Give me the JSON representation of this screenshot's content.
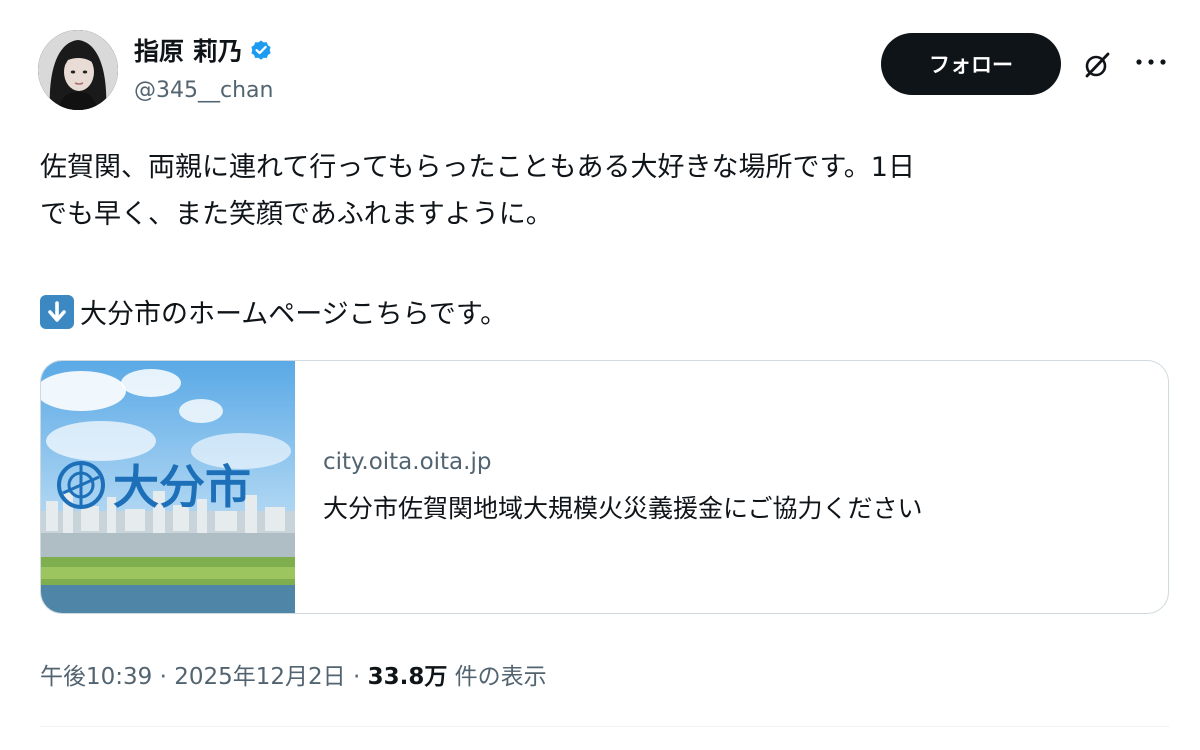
{
  "author": {
    "display_name": "指原 莉乃",
    "handle": "@345__chan",
    "verified": true,
    "avatar": "portrait-photo"
  },
  "header": {
    "follow_label": "フォロー",
    "grok_icon": "grok-slash-circle-icon",
    "more_icon": "more-dots-icon"
  },
  "tweet": {
    "text": "佐賀関、両親に連れて行ってもらったこともある大好きな場所です。1日\nでも早く、また笑顔であふれますように。",
    "link_line_emoji": "down-arrow-emoji",
    "link_line_text": "大分市のホームページこちらです。"
  },
  "card": {
    "thumbnail_logo_text": "大分市",
    "domain": "city.oita.oita.jp",
    "title": "大分市佐賀関地域大規模火災義援金にご協力ください"
  },
  "meta": {
    "time": "午後10:39",
    "sep1": " · ",
    "date": "2025年12月2日",
    "sep2": " · ",
    "views_count": "33.8万",
    "views_label": " 件の表示"
  },
  "colors": {
    "text_primary": "#0f1419",
    "text_secondary": "#536471",
    "verified_blue": "#1d9bf0",
    "follow_bg": "#0f1419",
    "border": "#cfd9de"
  }
}
